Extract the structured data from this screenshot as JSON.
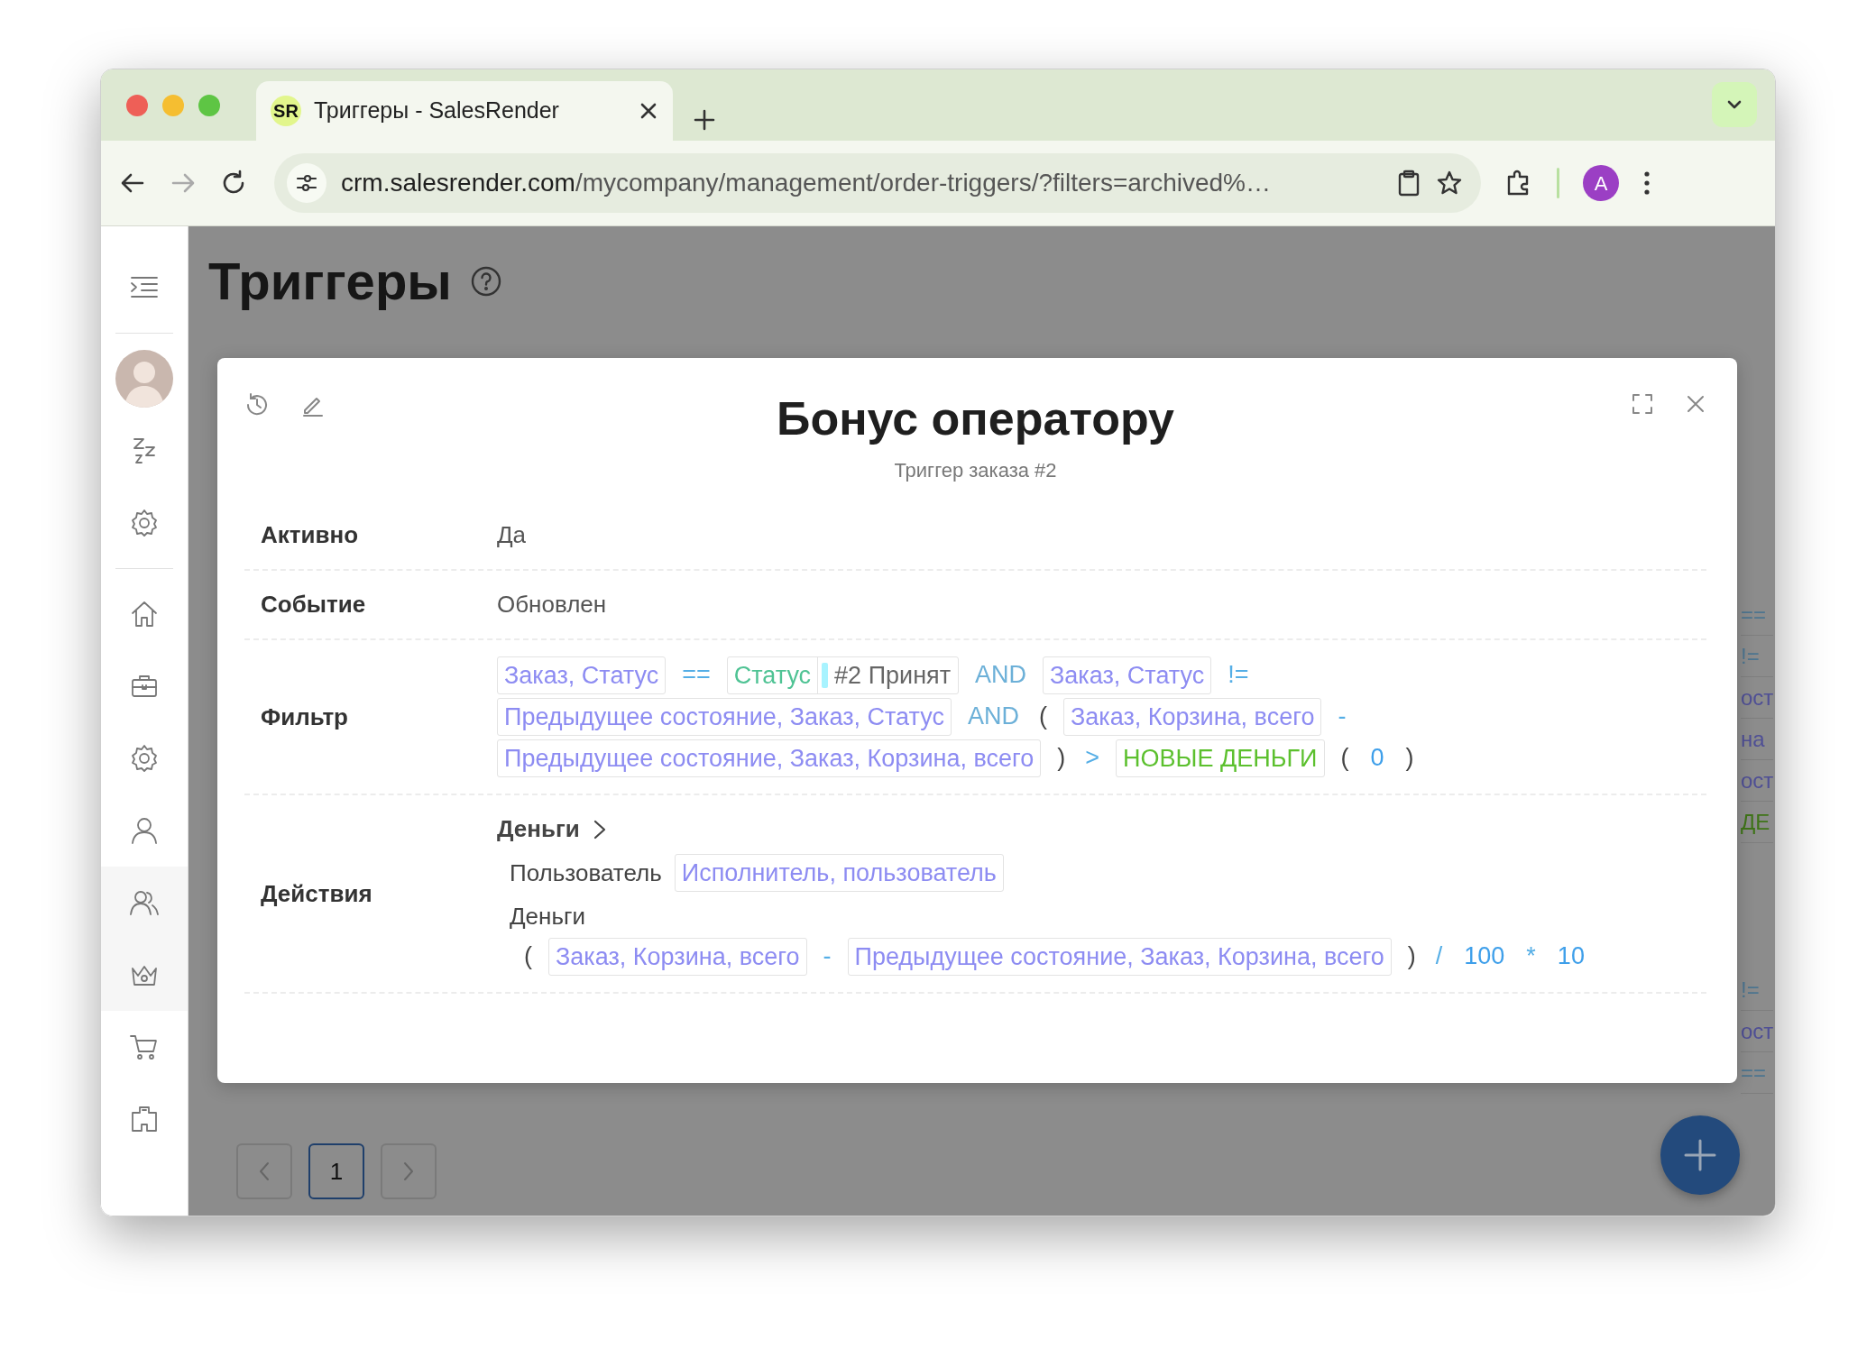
{
  "browser": {
    "tab": {
      "logo": "SR",
      "title": "Триггеры - SalesRender",
      "selected": true
    },
    "address": {
      "domain": "crm.salesrender.com",
      "path": "/mycompany/management/order-triggers/?filters=archived%…"
    },
    "profile": "A"
  },
  "page": {
    "title": "Триггеры"
  },
  "background_rows": [
    {
      "fragments": [
        {
          "kind": "operator",
          "text": "=="
        },
        {
          "kind": "operator",
          "text": "!="
        },
        {
          "kind": "field",
          "text": "ост"
        },
        {
          "kind": "field",
          "text": "на"
        },
        {
          "kind": "field",
          "text": "ост"
        },
        {
          "kind": "function",
          "text": "ДЕ"
        }
      ]
    },
    {
      "fragments": [
        {
          "kind": "operator",
          "text": "!="
        },
        {
          "kind": "field",
          "text": "ост"
        },
        {
          "kind": "operator",
          "text": "=="
        }
      ]
    }
  ],
  "modal": {
    "title": "Бонус оператору",
    "subtitle": "Триггер заказа #2",
    "rows": [
      {
        "label": "Активно",
        "kind": "text",
        "value": "Да"
      },
      {
        "label": "Событие",
        "kind": "text",
        "value": "Обновлен"
      },
      {
        "label": "Фильтр",
        "kind": "expression",
        "tokens": [
          {
            "kind": "field",
            "text": "Заказ, Статус"
          },
          {
            "kind": "operator",
            "text": "=="
          },
          {
            "kind": "status",
            "label": "Статус",
            "color": "#a8f3ff",
            "value": "#2 Принят"
          },
          {
            "kind": "keyword",
            "text": "AND"
          },
          {
            "kind": "field",
            "text": "Заказ, Статус"
          },
          {
            "kind": "operator",
            "text": "!="
          },
          {
            "kind": "field",
            "text": "Предыдущее состояние, Заказ, Статус"
          },
          {
            "kind": "keyword",
            "text": "AND"
          },
          {
            "kind": "paren",
            "text": "("
          },
          {
            "kind": "field",
            "text": "Заказ, Корзина, всего"
          },
          {
            "kind": "operator",
            "text": "-"
          },
          {
            "kind": "field",
            "text": "Предыдущее состояние, Заказ, Корзина, всего"
          },
          {
            "kind": "paren",
            "text": ")"
          },
          {
            "kind": "operator",
            "text": ">"
          },
          {
            "kind": "function",
            "text": "НОВЫЕ ДЕНЬГИ"
          },
          {
            "kind": "paren",
            "text": "("
          },
          {
            "kind": "number",
            "text": "0"
          },
          {
            "kind": "paren",
            "text": ")"
          }
        ]
      },
      {
        "label": "Действия",
        "kind": "actions",
        "actions": [
          {
            "title": "Деньги",
            "params": [
              {
                "label": "Пользователь",
                "kind": "inline",
                "tokens": [
                  {
                    "kind": "field",
                    "text": "Исполнитель, пользователь"
                  }
                ]
              },
              {
                "label": "Деньги",
                "kind": "block",
                "tokens": [
                  {
                    "kind": "paren",
                    "text": "("
                  },
                  {
                    "kind": "field",
                    "text": "Заказ, Корзина, всего"
                  },
                  {
                    "kind": "operator",
                    "text": "-"
                  },
                  {
                    "kind": "field",
                    "text": "Предыдущее состояние, Заказ, Корзина, всего"
                  },
                  {
                    "kind": "paren",
                    "text": ")"
                  },
                  {
                    "kind": "operator",
                    "text": "/"
                  },
                  {
                    "kind": "number",
                    "text": "100"
                  },
                  {
                    "kind": "operator",
                    "text": "*"
                  },
                  {
                    "kind": "number",
                    "text": "10"
                  }
                ]
              }
            ]
          }
        ]
      }
    ]
  },
  "pagination": {
    "pages": [
      {
        "label": "1",
        "selected": true
      }
    ]
  }
}
